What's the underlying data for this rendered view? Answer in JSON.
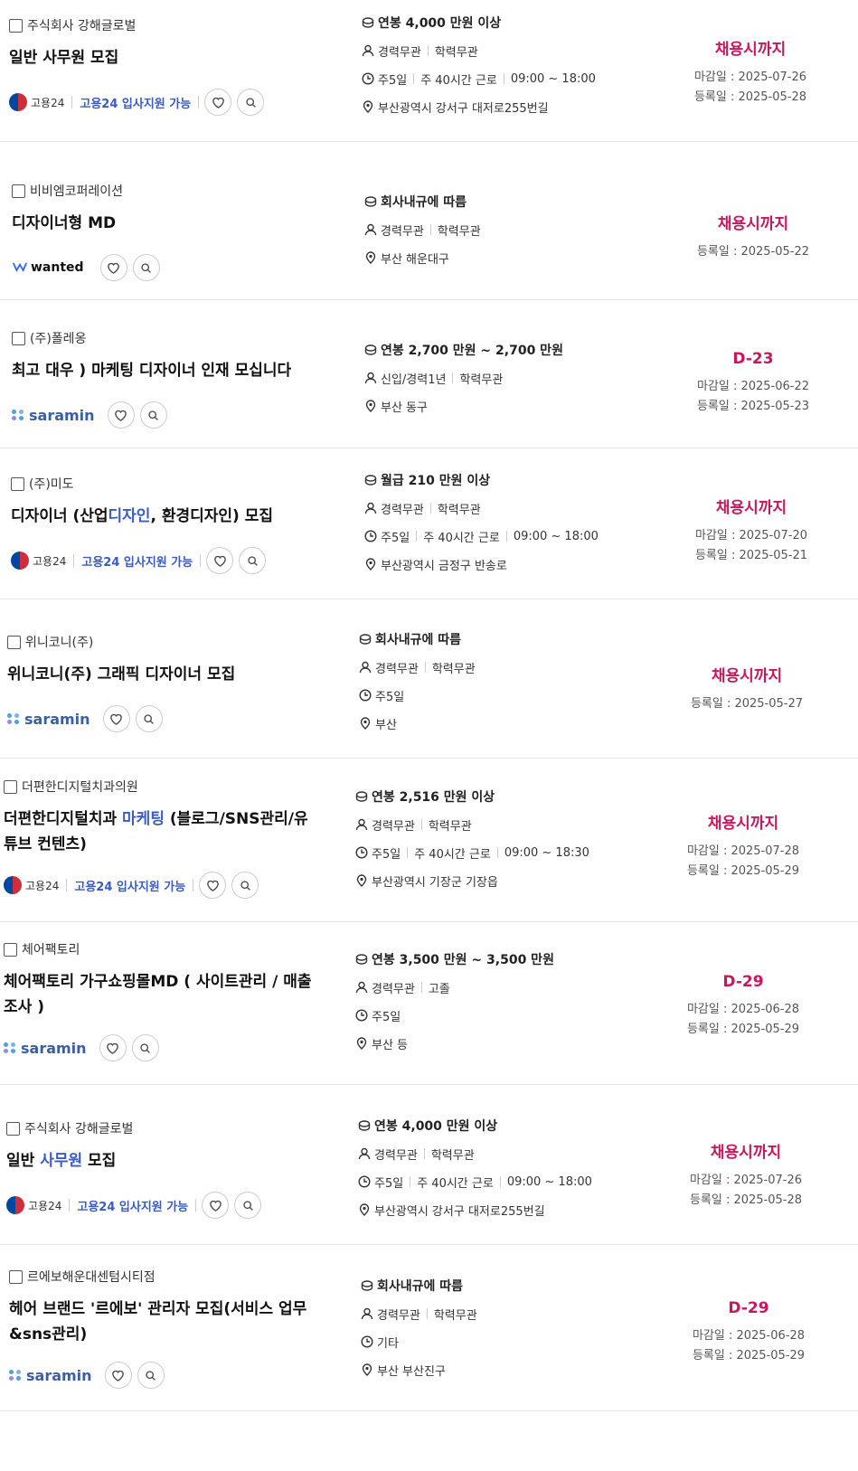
{
  "jobs": [
    {
      "company": "주식회사 강해글로벌",
      "title_parts": [
        {
          "t": "일반 사무원 모집",
          "hl": false
        }
      ],
      "source": "gov24",
      "logo_text": "고용24",
      "support_text": "고용24 입사지원 가능",
      "pay": "연봉 4,000 만원 이상",
      "career": "경력무관",
      "education": "학력무관",
      "schedule": [
        "주5일",
        "주 40시간 근로",
        "09:00 ~ 18:00"
      ],
      "location": "부산광역시 강서구 대저로255번길",
      "deadline": "채용시까지",
      "close_date": "마감일 : 2025-07-26",
      "reg_date": "등록일 : 2025-05-28"
    },
    {
      "company": "비비엠코퍼레이션",
      "title_parts": [
        {
          "t": "디자이너형 MD",
          "hl": false
        }
      ],
      "source": "wanted",
      "logo_text": "wanted",
      "support_text": "",
      "pay": "회사내규에 따름",
      "career": "경력무관",
      "education": "학력무관",
      "schedule": [],
      "location": "부산 해운대구",
      "deadline": "채용시까지",
      "close_date": "",
      "reg_date": "등록일 : 2025-05-22"
    },
    {
      "company": "(주)폴레옹",
      "title_parts": [
        {
          "t": "최고 대우 ) 마케팅 디자이너 인재 모십니다",
          "hl": false
        }
      ],
      "source": "saramin",
      "logo_text": "saramin",
      "support_text": "",
      "pay": "연봉 2,700 만원 ~ 2,700 만원",
      "career": "신입/경력1년",
      "education": "학력무관",
      "schedule": [],
      "location": "부산 동구",
      "deadline": "D-23",
      "close_date": "마감일 : 2025-06-22",
      "reg_date": "등록일 : 2025-05-23"
    },
    {
      "company": "(주)미도",
      "title_parts": [
        {
          "t": "디자이너 (산업",
          "hl": false
        },
        {
          "t": "디자인",
          "hl": true
        },
        {
          "t": ", 환경디자인) 모집",
          "hl": false
        }
      ],
      "source": "gov24",
      "logo_text": "고용24",
      "support_text": "고용24 입사지원 가능",
      "pay": "월급 210 만원 이상",
      "career": "경력무관",
      "education": "학력무관",
      "schedule": [
        "주5일",
        "주 40시간 근로",
        "09:00 ~ 18:00"
      ],
      "location": "부산광역시 금정구 반송로",
      "deadline": "채용시까지",
      "close_date": "마감일 : 2025-07-20",
      "reg_date": "등록일 : 2025-05-21"
    },
    {
      "company": "위니코니(주)",
      "title_parts": [
        {
          "t": "위니코니(주) 그래픽 디자이너 모집",
          "hl": false
        }
      ],
      "source": "saramin",
      "logo_text": "saramin",
      "support_text": "",
      "pay": "회사내규에 따름",
      "career": "경력무관",
      "education": "학력무관",
      "schedule": [
        "주5일"
      ],
      "location": "부산",
      "deadline": "채용시까지",
      "close_date": "",
      "reg_date": "등록일 : 2025-05-27"
    },
    {
      "company": "더편한디지털치과의원",
      "title_parts": [
        {
          "t": "더편한디지털치과 ",
          "hl": false
        },
        {
          "t": "마케팅",
          "hl": true
        },
        {
          "t": " (블로그/SNS관리/유튜브 컨텐츠)",
          "hl": false
        }
      ],
      "source": "gov24",
      "logo_text": "고용24",
      "support_text": "고용24 입사지원 가능",
      "pay": "연봉 2,516 만원 이상",
      "career": "경력무관",
      "education": "학력무관",
      "schedule": [
        "주5일",
        "주 40시간 근로",
        "09:00 ~ 18:30"
      ],
      "location": "부산광역시 기장군 기장읍",
      "deadline": "채용시까지",
      "close_date": "마감일 : 2025-07-28",
      "reg_date": "등록일 : 2025-05-29"
    },
    {
      "company": "체어팩토리",
      "title_parts": [
        {
          "t": "체어팩토리 가구쇼핑몰MD ( 사이트관리 / 매출조사 )",
          "hl": false
        }
      ],
      "source": "saramin",
      "logo_text": "saramin",
      "support_text": "",
      "pay": "연봉 3,500 만원 ~ 3,500 만원",
      "career": "경력무관",
      "education": "고졸",
      "schedule": [
        "주5일"
      ],
      "location": "부산 등",
      "deadline": "D-29",
      "close_date": "마감일 : 2025-06-28",
      "reg_date": "등록일 : 2025-05-29"
    },
    {
      "company": "주식회사 강해글로벌",
      "title_parts": [
        {
          "t": "일반 ",
          "hl": false
        },
        {
          "t": "사무원",
          "hl": true
        },
        {
          "t": " 모집",
          "hl": false
        }
      ],
      "source": "gov24",
      "logo_text": "고용24",
      "support_text": "고용24 입사지원 가능",
      "pay": "연봉 4,000 만원 이상",
      "career": "경력무관",
      "education": "학력무관",
      "schedule": [
        "주5일",
        "주 40시간 근로",
        "09:00 ~ 18:00"
      ],
      "location": "부산광역시 강서구 대저로255번길",
      "deadline": "채용시까지",
      "close_date": "마감일 : 2025-07-26",
      "reg_date": "등록일 : 2025-05-28"
    },
    {
      "company": "르에보해운대센텀시티점",
      "title_parts": [
        {
          "t": "헤어 브랜드 '르에보' 관리자 모집(서비스 업무&sns관리)",
          "hl": false
        }
      ],
      "source": "saramin",
      "logo_text": "saramin",
      "support_text": "",
      "pay": "회사내규에 따름",
      "career": "경력무관",
      "education": "학력무관",
      "schedule": [
        "기타"
      ],
      "location": "부산 부산진구",
      "deadline": "D-29",
      "close_date": "마감일 : 2025-06-28",
      "reg_date": "등록일 : 2025-05-29"
    }
  ],
  "colors": {
    "accent": "#c8175d",
    "link": "#3a5bc7",
    "divider": "#e3e3e3"
  },
  "icons": {
    "pay": "coin-icon",
    "career": "person-icon",
    "schedule": "clock-icon",
    "location": "pin-icon",
    "like": "heart-icon",
    "search": "search-icon"
  }
}
